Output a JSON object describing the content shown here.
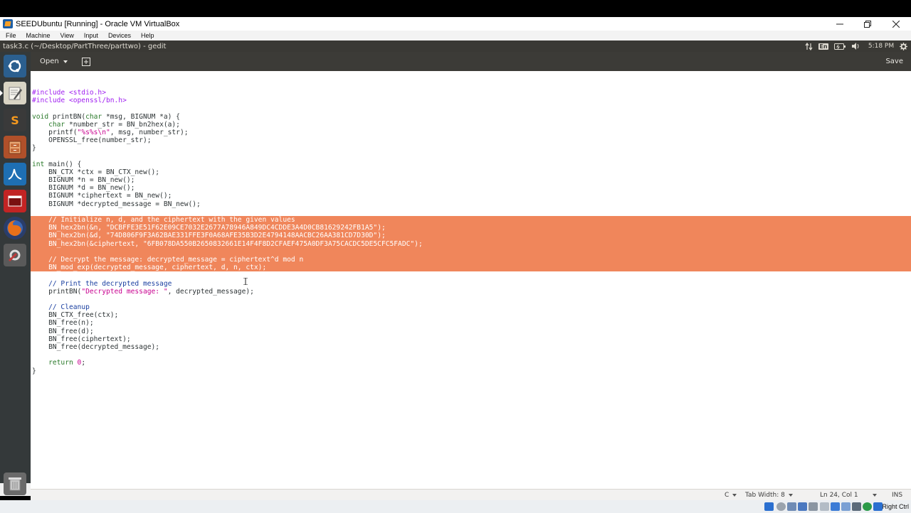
{
  "host_window": {
    "title": "SEEDUbuntu [Running] - Oracle VM VirtualBox",
    "controls": [
      "minimize",
      "restore",
      "close"
    ],
    "menu": [
      "File",
      "Machine",
      "View",
      "Input",
      "Devices",
      "Help"
    ],
    "host_key_label": "Right Ctrl"
  },
  "ubuntu_panel": {
    "window_title": "task3.c (~/Desktop/PartThree/parttwo) - gedit",
    "keyboard_layout": "En",
    "clock": "5:18 PM",
    "indicators": [
      "network-arrows-icon",
      "keyboard-icon",
      "battery-icon",
      "volume-icon",
      "clock",
      "settings-gear-icon"
    ]
  },
  "launcher": {
    "items": [
      {
        "name": "ubuntu-dash-icon",
        "color": "#2b5f8f"
      },
      {
        "name": "text-editor-icon",
        "color": "#d8d4c4"
      },
      {
        "name": "sublime-text-icon",
        "color": "#3a3a3a",
        "glyph": "S"
      },
      {
        "name": "file-manager-icon",
        "color": "#b0502a"
      },
      {
        "name": "wireshark-icon",
        "color": "#1e6fb3"
      },
      {
        "name": "terminal-app-icon",
        "color": "#c22424"
      },
      {
        "name": "firefox-icon",
        "color": "#e8701a"
      },
      {
        "name": "system-settings-icon",
        "color": "#c03a3a"
      },
      {
        "name": "trash-icon",
        "color": "#9a9a9a"
      }
    ]
  },
  "gedit": {
    "open_label": "Open",
    "save_label": "Save",
    "selected_lines": [
      17,
      18,
      19,
      20,
      21,
      22,
      23
    ],
    "code_lines": [
      [
        {
          "t": "#include <stdio.h>",
          "c": "pp"
        }
      ],
      [
        {
          "t": "#include <openssl/bn.h>",
          "c": "pp"
        }
      ],
      [],
      [
        {
          "t": "void",
          "c": "kw"
        },
        {
          "t": " printBN("
        },
        {
          "t": "char",
          "c": "kw"
        },
        {
          "t": " *msg, BIGNUM *a) {"
        }
      ],
      [
        {
          "t": "    "
        },
        {
          "t": "char",
          "c": "kw"
        },
        {
          "t": " *number_str = BN_bn2hex(a);"
        }
      ],
      [
        {
          "t": "    printf("
        },
        {
          "t": "\"%s%s\\n\"",
          "c": "str"
        },
        {
          "t": ", msg, number_str);"
        }
      ],
      [
        {
          "t": "    OPENSSL_free(number_str);"
        }
      ],
      [
        {
          "t": "}"
        }
      ],
      [],
      [
        {
          "t": "int",
          "c": "kw"
        },
        {
          "t": " main() {"
        }
      ],
      [
        {
          "t": "    BN_CTX *ctx = BN_CTX_new();"
        }
      ],
      [
        {
          "t": "    BIGNUM *n = BN_new();"
        }
      ],
      [
        {
          "t": "    BIGNUM *d = BN_new();"
        }
      ],
      [
        {
          "t": "    BIGNUM *ciphertext = BN_new();"
        }
      ],
      [
        {
          "t": "    BIGNUM *decrypted_message = BN_new();"
        }
      ],
      [],
      [
        {
          "t": "    "
        },
        {
          "t": "// Initialize n, d, and the ciphertext with the given values",
          "c": "cmt"
        }
      ],
      [
        {
          "t": "    BN_hex2bn(&n, "
        },
        {
          "t": "\"DCBFFE3E51F62E09CE7032E2677A78946A849DC4CDDE3A4D0CB81629242FB1A5\"",
          "c": "str"
        },
        {
          "t": ");"
        }
      ],
      [
        {
          "t": "    BN_hex2bn(&d, "
        },
        {
          "t": "\"74D806F9F3A62BAE331FFE3F0A68AFE35B3D2E4794148AACBC26AA381CD7D30D\"",
          "c": "str"
        },
        {
          "t": ");"
        }
      ],
      [
        {
          "t": "    BN_hex2bn(&ciphertext, "
        },
        {
          "t": "\"6FB078DA550B2650832661E14F4F8D2CFAEF475A0DF3A75CACDC5DE5CFC5FADC\"",
          "c": "str"
        },
        {
          "t": ");"
        }
      ],
      [],
      [
        {
          "t": "    "
        },
        {
          "t": "// Decrypt the message: decrypted_message = ciphertext^d mod n",
          "c": "cmt"
        }
      ],
      [
        {
          "t": "    BN_mod_exp(decrypted_message, ciphertext, d, n, ctx);"
        }
      ],
      [],
      [
        {
          "t": "    "
        },
        {
          "t": "// Print the decrypted message",
          "c": "cmt"
        }
      ],
      [
        {
          "t": "    printBN("
        },
        {
          "t": "\"Decrypted message: \"",
          "c": "str"
        },
        {
          "t": ", decrypted_message);"
        }
      ],
      [],
      [
        {
          "t": "    "
        },
        {
          "t": "// Cleanup",
          "c": "cmt"
        }
      ],
      [
        {
          "t": "    BN_CTX_free(ctx);"
        }
      ],
      [
        {
          "t": "    BN_free(n);"
        }
      ],
      [
        {
          "t": "    BN_free(d);"
        }
      ],
      [
        {
          "t": "    BN_free(ciphertext);"
        }
      ],
      [
        {
          "t": "    BN_free(decrypted_message);"
        }
      ],
      [],
      [
        {
          "t": "    "
        },
        {
          "t": "return",
          "c": "kw"
        },
        {
          "t": " "
        },
        {
          "t": "0",
          "c": "num"
        },
        {
          "t": ";"
        }
      ],
      [
        {
          "t": "}"
        }
      ]
    ],
    "statusbar": {
      "language": "C",
      "tab_width": "Tab Width: 8",
      "position": "Ln 24, Col 1",
      "mode": "INS"
    }
  },
  "colors": {
    "selection": "#f0865b",
    "panel": "#3a3935",
    "launcher": "#34393a",
    "toolbar": "#3c3b37"
  }
}
